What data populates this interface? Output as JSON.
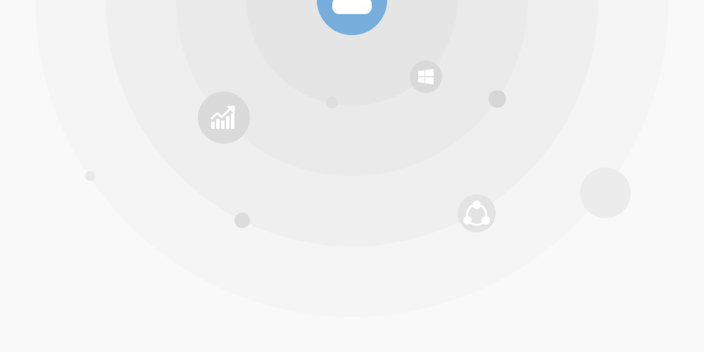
{
  "background": {
    "color": "#f9f9f9",
    "ring_colors": [
      "#f5f5f5",
      "#efefef",
      "#eaeaea",
      "#e5e5e5"
    ]
  },
  "hub": {
    "icon": "cloud-icon",
    "color": "#78aedc"
  },
  "nodes": [
    {
      "icon": "growth-chart-icon",
      "color": "#dadada"
    },
    {
      "icon": "windows-logo-icon",
      "color": "#d9d9d9"
    },
    {
      "icon": "share-network-icon",
      "color": "#e3e3e3"
    }
  ],
  "decorative_dots": 5
}
